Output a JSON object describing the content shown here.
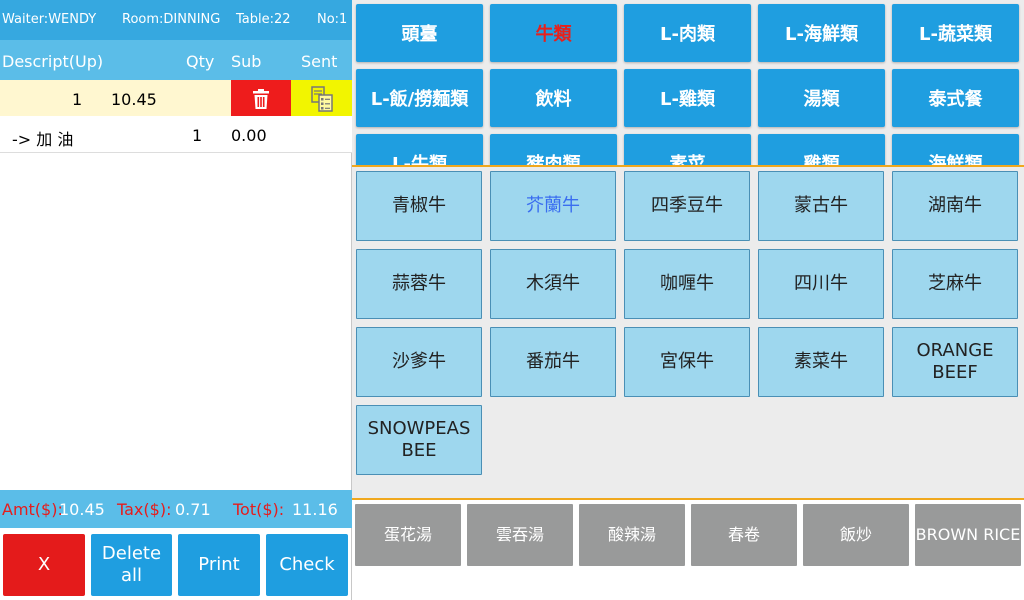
{
  "header": {
    "waiter": "Waiter:WENDY",
    "room": "Room:DINNING",
    "table": "Table:22",
    "no": "No:1"
  },
  "columns": {
    "descript": "Descript(Up)",
    "qty": "Qty",
    "sub": "Sub",
    "sent": "Sent"
  },
  "order": {
    "rows": [
      {
        "qty": "1",
        "price": "10.45"
      },
      {
        "desc": "-> 加 油",
        "qty": "1",
        "price": "0.00"
      }
    ]
  },
  "totals": {
    "amt_label": "Amt($):",
    "amt_value": "10.45",
    "tax_label": "Tax($):",
    "tax_value": "0.71",
    "tot_label": "Tot($):",
    "tot_value": "11.16"
  },
  "actions": {
    "x": "X",
    "delete_all": "Delete all",
    "print": "Print",
    "check": "Check"
  },
  "categories": [
    "頭臺",
    "牛類",
    "L-肉類",
    "L-海鮮類",
    "L-蔬菜類",
    "L-飯/撈麵類",
    "飲料",
    "L-雞類",
    "湯類",
    "泰式餐",
    "L-牛類",
    "豬肉類",
    "素菜",
    "雞類",
    "海鮮類"
  ],
  "selected_category": "牛類",
  "items": [
    "青椒牛",
    "芥蘭牛",
    "四季豆牛",
    "蒙古牛",
    "湖南牛",
    "蒜蓉牛",
    "木須牛",
    "咖喱牛",
    "四川牛",
    "芝麻牛",
    "沙爹牛",
    "番茄牛",
    "宮保牛",
    "素菜牛",
    "ORANGE BEEF",
    "SNOWPEAS BEE"
  ],
  "selected_item": "芥蘭牛",
  "quick_items": [
    "蛋花湯",
    "雲吞湯",
    "酸辣湯",
    "春卷",
    "飯炒",
    "BROWN RICE"
  ],
  "colors": {
    "header_blue": "#36a8e0",
    "category_blue": "#1f9ee0",
    "item_blue": "#9ed7ee",
    "delete_red": "#ee1c1c",
    "sent_yellow": "#f2f500",
    "divider_orange": "#f0a81e",
    "quick_gray": "#999a9a"
  },
  "icons": {
    "delete": "trash-icon",
    "sent": "kitchen-ticket-icon"
  }
}
